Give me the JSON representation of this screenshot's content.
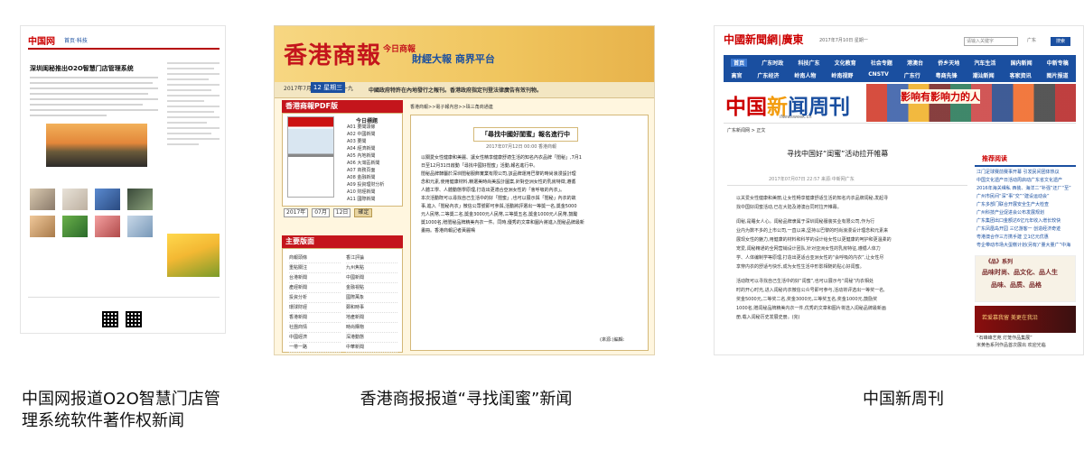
{
  "captions": {
    "left": "中国网报道O2O智慧门店管理系统软件著作权新闻",
    "middle": "香港商报报道“寻找闺蜜”新闻",
    "right": "中国新周刊"
  },
  "panel1": {
    "logo": "中国网",
    "logo_sub": "首页·科技",
    "headline": "深圳闺秘推出O2O智慧门店管理系统"
  },
  "panel2": {
    "brand": "香港商報",
    "brand_sub": "今日商報",
    "slogan": "財經大報  商界平台",
    "date": "2017年7月 丁酉年 六月十九",
    "day_number": "12",
    "weekday": "星期三",
    "ticker": "中國政府特許在內地發行之報刊。香港政府指定刊登法律廣告有效刊物。",
    "pdf_title": "香港商報PDF版",
    "toc_title": "今日標題",
    "toc": [
      "A01 要聞頭條",
      "A02 中國新聞",
      "A03 要聞",
      "A04 經濟新聞",
      "A05 內地新聞",
      "A06 大灣區新聞",
      "A07 商務頁面",
      "A08 金融新聞",
      "A09 投資理財分析",
      "A10 財經新聞",
      "A11 國際新聞",
      "A12 科技新聞"
    ],
    "selects": {
      "year": "2017年",
      "month": "07月",
      "day": "12日",
      "go": "確定"
    },
    "sections_title": "主要版面",
    "sections": [
      "商報頭條",
      "香江評論",
      "重點關注",
      "九州焦點",
      "台港新聞",
      "中國新聞",
      "產經新聞",
      "金融視點",
      "投資分析",
      "國際萬象",
      "環球財經",
      "鄭和時事",
      "香港新聞",
      "地產新聞",
      "社團商情",
      "時尚購物",
      "中國經濟",
      "深港動態",
      "一帶一路",
      "中華新聞"
    ],
    "crumb": "香港商報>>電子報內容>>珠三角商通連",
    "article_title": "「尋找中國好閨蜜」報名進行中",
    "article_meta": "2017年07月12日 00:00  香港商報",
    "article_body": [
      "以關愛女性健康和美麗、讓女性精享健康舒適生活的知名內衣品牌「閨秘」,7月1",
      "日至12月31日啟動「尋找中國好閨蜜」活動,報名進行中。",
      "",
      "閨秘品牌隸屬於深圳閨秘服飾實業有限公司,該品牌運用巴黎的時尚浪漫設計理",
      "念和元素,使用健康材料,精選美時尚美設計圖案,針對亞洲女性的乳房特徵,遵循",
      "人體工學、人體動態學原理,打造出更適合亞洲女性的「會呼吸的內衣」。",
      "",
      "本次活動既可以尋找自己生活中的好「閨蜜」,也可以展示與「閨秘」內衣的故",
      "事,進入「閨秘內衣」微信公眾號即可參與,活動將評選出一等獎一名,獎金5000",
      "元人民幣,二等獎二名,獎金3000元人民幣,三等獎五名,獎金1000元人民幣,鼓勵",
      "獎1000名,贈閨秘品牌精美內衣一件。同時,優秀的文章和圖片將進入閨秘品牌最新",
      "畫冊。香港商報記者黃麗鳴"
    ],
    "editor": "(來源:)編輯:"
  },
  "panel3": {
    "logo": "中國新聞網|廣東",
    "logo_eng": "www.gd.chinanews.com",
    "date": "2017年7月10日 星期一",
    "search_placeholder": "请输入关键字",
    "search_select": "广东",
    "search_btn": "搜索",
    "nav_row1": [
      "首页",
      "广东时政",
      "科技广东",
      "文化教育",
      "社会专题",
      "港澳台",
      "侨乡天地",
      "汽车生活",
      "国内新闻",
      "中新专稿"
    ],
    "nav_row2": [
      "高官",
      "广东经济",
      "岭南人物",
      "岭南视野",
      "CNSTV",
      "广东行",
      "粤商先锋",
      "潮汕新闻",
      "客家资讯",
      "图片报道"
    ],
    "banner_logo_a": "中国",
    "banner_logo_b": "新",
    "banner_logo_c": "闻周刊",
    "banner_eng": "iNewsweek.cn",
    "banner_slogan": "影响有影响力的人",
    "crumb": "广东新闻网 > 正文",
    "article_title": "寻找中国好“闺蜜”活动拉开帷幕",
    "article_meta": "2017年07月07日 22:57  来源:中新网广东",
    "article_body": [
      "以关爱女性健康和美丽,让女性畅享健康舒适生活的知名内衣品牌闺秘,发起寻",
      "找中国好闺蜜活动,已在大陆及港澳台同时拉开帷幕。",
      "",
      "闺秘,是睡女人心。闺秘品牌隶属于深圳闺秘服装实业有限公司,作为行",
      "业内为数不多的上市公司,一直以来,坚持以巴黎的时尚浪漫设计理念和元素来",
      "展现女性的魅力,用健康的材料和科学的设计给女性以更健康的呵护和更温柔的",
      "宠爱,闺秘精通的全网营销设计团队,针对亚洲女性的乳房特征,遵循人体力",
      "学、人体编制学等原理,打造出更适合亚洲女性的“会呼吸的内衣”,让女性尽",
      "享穿内衣的舒适与快乐,成为女性生活中形影相随的贴心好闺蜜。",
      "",
      "活动既可以寻找自己生活中的好“闺蜜”,也可以展示与“闺秘”内衣相处",
      "时的开心时光,进入闺秘内衣微信公众号即可参与,活动将评选出一等奖一名,",
      "奖金5000元,二等奖二名,奖金3000元,三等奖五名,奖金1000元,鼓励奖",
      "1000名,赠闺秘品牌精美内衣一件,优秀的文章和图片将选入闺秘品牌最新画",
      "册,载入闺秘历史发展史册。(完)"
    ],
    "recommend_title": "推荐阅读",
    "recommend": [
      "江门足球赛前赛事开幕 引发民间团体热议",
      "中国文化遗产日活动周启动广东省文化遗产",
      "2016年海关缉私 西装、海洋二“补强”还厂“至”",
      "广州市民间“深”事“交”“建设运动会”",
      "广东多部门联合开展安全生产大检查",
      "广州科技产业促进会公布发展规划",
      "广东集团出口金额达6亿元年收入增长较快",
      "广东凤凰岛开园 三亿游客一 创造经济奇迹",
      "粤港澳合作三方携手建 立1亿元优惠",
      "粤企带动市场大蛋糕计划(另有)“量大量广”中海"
    ],
    "ad1_line1": "《品》系列",
    "ad1_line2": "品味时尚、品文化、品人生",
    "ad1_line3": "品味、品质、品格",
    "ad2_text": "若爱慕我留 美更在我沿",
    "ad3_line1": "“石峰峰艺苑 灯笼作品集展”",
    "ad3_line2": "米黄色系列作品首次展出 欢迎光临"
  }
}
